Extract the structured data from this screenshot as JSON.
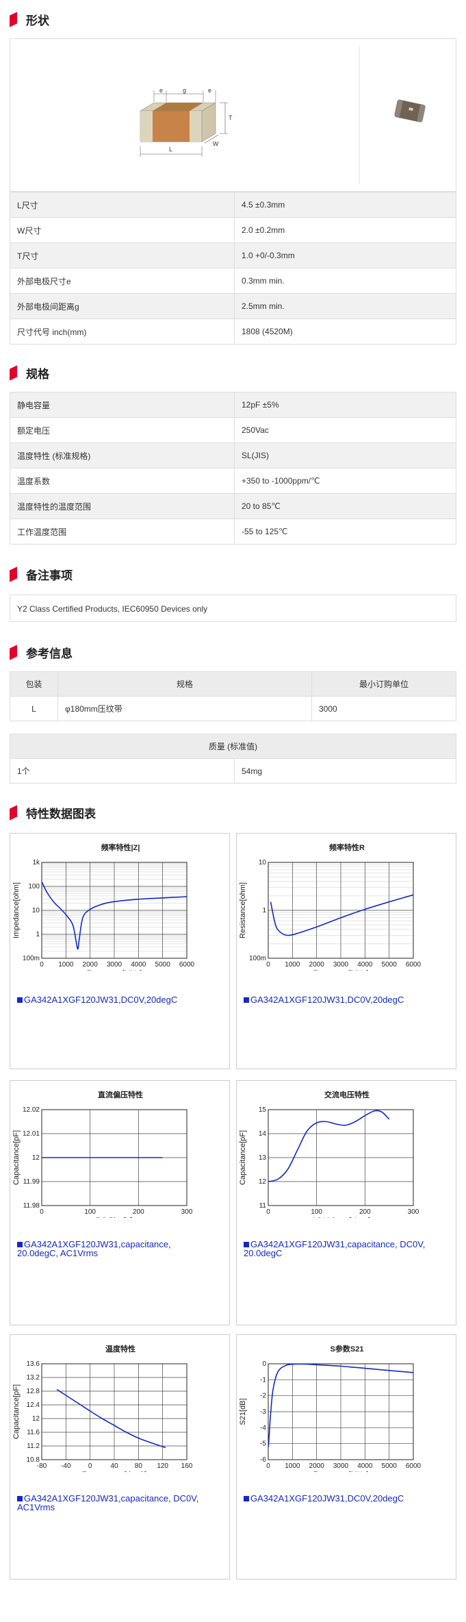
{
  "shape": {
    "title": "形状",
    "diagram_labels": {
      "e1": "e",
      "g": "g",
      "e2": "e",
      "T": "T",
      "W": "W",
      "L": "L"
    },
    "rows": [
      {
        "k": "L尺寸",
        "v": "4.5 ±0.3mm"
      },
      {
        "k": "W尺寸",
        "v": "2.0 ±0.2mm"
      },
      {
        "k": "T尺寸",
        "v": "1.0 +0/-0.3mm"
      },
      {
        "k": "外部电极尺寸e",
        "v": "0.3mm min."
      },
      {
        "k": "外部电极间距离g",
        "v": "2.5mm min."
      },
      {
        "k": "尺寸代号 inch(mm)",
        "v": "1808 (4520M)"
      }
    ]
  },
  "spec": {
    "title": "规格",
    "rows": [
      {
        "k": "静电容量",
        "v": "12pF ±5%"
      },
      {
        "k": "额定电压",
        "v": "250Vac"
      },
      {
        "k": "温度特性 (标准规格)",
        "v": "SL(JIS)"
      },
      {
        "k": "温度系数",
        "v": "+350 to -1000ppm/℃"
      },
      {
        "k": "温度特性的温度范围",
        "v": "20 to 85℃"
      },
      {
        "k": "工作温度范围",
        "v": "-55 to 125℃"
      }
    ]
  },
  "notes": {
    "title": "备注事项",
    "text": "Y2 Class Certified Products, IEC60950 Devices only"
  },
  "reference": {
    "title": "参考信息",
    "headers": [
      "包装",
      "规格",
      "最小订购单位"
    ],
    "row": [
      "L",
      "φ180mm压纹带",
      "3000"
    ],
    "mass_header": "质量 (标准值)",
    "mass_row": [
      "1个",
      "54mg"
    ]
  },
  "charts_section": {
    "title": "特性数据图表"
  },
  "colors": {
    "accent": "#e4002b",
    "curve": "#1428c8"
  },
  "chart_data": [
    {
      "type": "line",
      "title": "频率特性|Z|",
      "xlabel": "Frequency[MHz]",
      "ylabel": "Impedance[ohm]",
      "yscale": "log",
      "xlim": [
        0,
        6000
      ],
      "ylim": [
        0.1,
        1000
      ],
      "xticks": [
        "0",
        "1000",
        "2000",
        "3000",
        "4000",
        "5000",
        "6000"
      ],
      "yticks": [
        "100m",
        "1",
        "10",
        "100",
        "1k"
      ],
      "legend": "GA342A1XGF120JW31,DC0V,20degC",
      "x": [
        10,
        200,
        500,
        800,
        1100,
        1300,
        1450,
        1500,
        1550,
        1700,
        2000,
        2500,
        3000,
        4000,
        5000,
        6000
      ],
      "y": [
        150,
        60,
        22,
        11,
        5,
        2.2,
        0.35,
        0.25,
        0.6,
        5,
        11,
        18,
        23,
        29,
        33,
        37
      ]
    },
    {
      "type": "line",
      "title": "频率特性R",
      "xlabel": "Frequency[MHz]",
      "ylabel": "Resistance[ohm]",
      "yscale": "log",
      "xlim": [
        0,
        6000
      ],
      "ylim": [
        0.1,
        10
      ],
      "xticks": [
        "0",
        "1000",
        "2000",
        "3000",
        "4000",
        "5000",
        "6000"
      ],
      "yticks": [
        "100m",
        "1",
        "10"
      ],
      "legend": "GA342A1XGF120JW31,DC0V,20degC",
      "x": [
        100,
        300,
        500,
        800,
        1200,
        2000,
        3000,
        4000,
        5000,
        6000
      ],
      "y": [
        1.5,
        0.5,
        0.35,
        0.3,
        0.33,
        0.45,
        0.7,
        1.05,
        1.5,
        2.1
      ]
    },
    {
      "type": "line",
      "title": "直流偏压特性",
      "xlabel": "DC Bias[V]",
      "ylabel": "Capacitance[pF]",
      "xlim": [
        0,
        300
      ],
      "ylim": [
        11.98,
        12.02
      ],
      "xticks": [
        "0",
        "100",
        "200",
        "300"
      ],
      "yticks": [
        "11.98",
        "11.99",
        "12",
        "12.01",
        "12.02"
      ],
      "legend": "GA342A1XGF120JW31,capacitance, 20.0degC, AC1Vrms",
      "x": [
        0,
        250
      ],
      "y": [
        12,
        12
      ]
    },
    {
      "type": "line",
      "title": "交流电压特性",
      "xlabel": "AC Voltage[Vrms]",
      "ylabel": "Capacitance[pF]",
      "xlim": [
        0,
        300
      ],
      "ylim": [
        11,
        15
      ],
      "xticks": [
        "0",
        "100",
        "200",
        "300"
      ],
      "yticks": [
        "11",
        "12",
        "13",
        "14",
        "15"
      ],
      "legend": "GA342A1XGF120JW31,capacitance, DC0V, 20.0degC",
      "x": [
        0,
        20,
        40,
        60,
        80,
        100,
        120,
        140,
        160,
        180,
        200,
        220,
        235,
        250
      ],
      "y": [
        12,
        12.1,
        12.5,
        13.3,
        14.1,
        14.45,
        14.5,
        14.4,
        14.35,
        14.5,
        14.75,
        14.95,
        14.9,
        14.6
      ]
    },
    {
      "type": "line",
      "title": "温度特性",
      "xlabel": "Temperature[degC]",
      "ylabel": "Capacitance[pF]",
      "xlim": [
        -80,
        160
      ],
      "ylim": [
        10.8,
        13.6
      ],
      "xticks": [
        "-80",
        "-40",
        "0",
        "40",
        "80",
        "120",
        "160"
      ],
      "yticks": [
        "10.8",
        "11.2",
        "11.6",
        "12",
        "12.4",
        "12.8",
        "13.2",
        "13.6"
      ],
      "legend": "GA342A1XGF120JW31,capacitance, DC0V, AC1Vrms",
      "x": [
        -55,
        -20,
        0,
        20,
        40,
        60,
        80,
        100,
        125
      ],
      "y": [
        12.85,
        12.45,
        12.22,
        12.0,
        11.8,
        11.6,
        11.43,
        11.3,
        11.15
      ]
    },
    {
      "type": "line",
      "title": "S参数S21",
      "xlabel": "Frequency[MHz]",
      "ylabel": "S21[dB]",
      "xlim": [
        0,
        6000
      ],
      "ylim": [
        -6,
        0
      ],
      "xticks": [
        "0",
        "1000",
        "2000",
        "3000",
        "4000",
        "5000",
        "6000"
      ],
      "yticks": [
        "-6",
        "-5",
        "-4",
        "-3",
        "-2",
        "-1",
        "0"
      ],
      "legend": "GA342A1XGF120JW31,DC0V,20degC",
      "x": [
        10,
        50,
        100,
        200,
        400,
        700,
        1000,
        1500,
        2000,
        3000,
        4000,
        5000,
        6000
      ],
      "y": [
        -5.2,
        -4.2,
        -3.1,
        -1.6,
        -0.5,
        -0.12,
        -0.03,
        -0.02,
        -0.06,
        -0.15,
        -0.28,
        -0.42,
        -0.55
      ]
    }
  ]
}
